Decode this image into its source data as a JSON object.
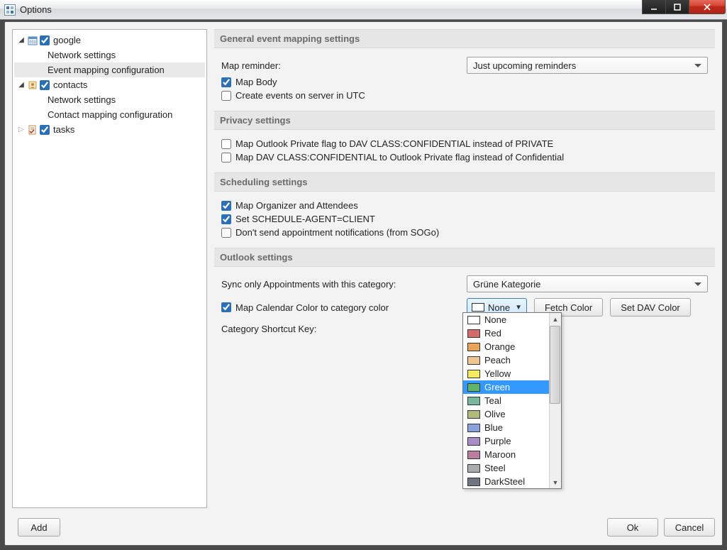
{
  "window": {
    "title": "Options"
  },
  "tree": {
    "items": [
      {
        "label": "google",
        "children": [
          "Network settings",
          "Event mapping configuration"
        ],
        "selected_child_index": 1
      },
      {
        "label": "contacts",
        "children": [
          "Network settings",
          "Contact mapping configuration"
        ]
      },
      {
        "label": "tasks"
      }
    ]
  },
  "sections": {
    "general": {
      "title": "General event mapping settings",
      "map_reminder_label": "Map reminder:",
      "map_reminder_value": "Just upcoming reminders",
      "map_body": "Map Body",
      "create_utc": "Create events on server in UTC"
    },
    "privacy": {
      "title": "Privacy settings",
      "opt1": "Map Outlook Private flag to DAV CLASS:CONFIDENTIAL instead of PRIVATE",
      "opt2": "Map DAV CLASS:CONFIDENTIAL to Outlook Private flag instead of Confidential"
    },
    "scheduling": {
      "title": "Scheduling settings",
      "opt1": "Map Organizer and Attendees",
      "opt2": "Set SCHEDULE-AGENT=CLIENT",
      "opt3": "Don't send appointment notifications (from SOGo)"
    },
    "outlook": {
      "title": "Outlook settings",
      "sync_label": "Sync only Appointments with this category:",
      "sync_value": "Grüne Kategorie",
      "map_color": "Map Calendar Color to category color",
      "shortcut_label": "Category Shortcut Key:",
      "color_combo_value": "None",
      "fetch_btn": "Fetch Color",
      "set_btn": "Set DAV Color"
    }
  },
  "color_dropdown": [
    {
      "name": "None",
      "swatch": "#ffffff",
      "highlight": false
    },
    {
      "name": "Red",
      "swatch": "#d46a6a",
      "highlight": false
    },
    {
      "name": "Orange",
      "swatch": "#e8a45a",
      "highlight": false
    },
    {
      "name": "Peach",
      "swatch": "#efc58f",
      "highlight": false
    },
    {
      "name": "Yellow",
      "swatch": "#f5eb62",
      "highlight": false
    },
    {
      "name": "Green",
      "swatch": "#5fb66a",
      "highlight": true
    },
    {
      "name": "Teal",
      "swatch": "#77b79b",
      "highlight": false
    },
    {
      "name": "Olive",
      "swatch": "#b1b87a",
      "highlight": false
    },
    {
      "name": "Blue",
      "swatch": "#8aa2d8",
      "highlight": false
    },
    {
      "name": "Purple",
      "swatch": "#a98cc8",
      "highlight": false
    },
    {
      "name": "Maroon",
      "swatch": "#b97d9d",
      "highlight": false
    },
    {
      "name": "Steel",
      "swatch": "#a9adb2",
      "highlight": false
    },
    {
      "name": "DarkSteel",
      "swatch": "#6d7681",
      "highlight": false
    }
  ],
  "buttons": {
    "add": "Add",
    "ok": "Ok",
    "cancel": "Cancel"
  }
}
